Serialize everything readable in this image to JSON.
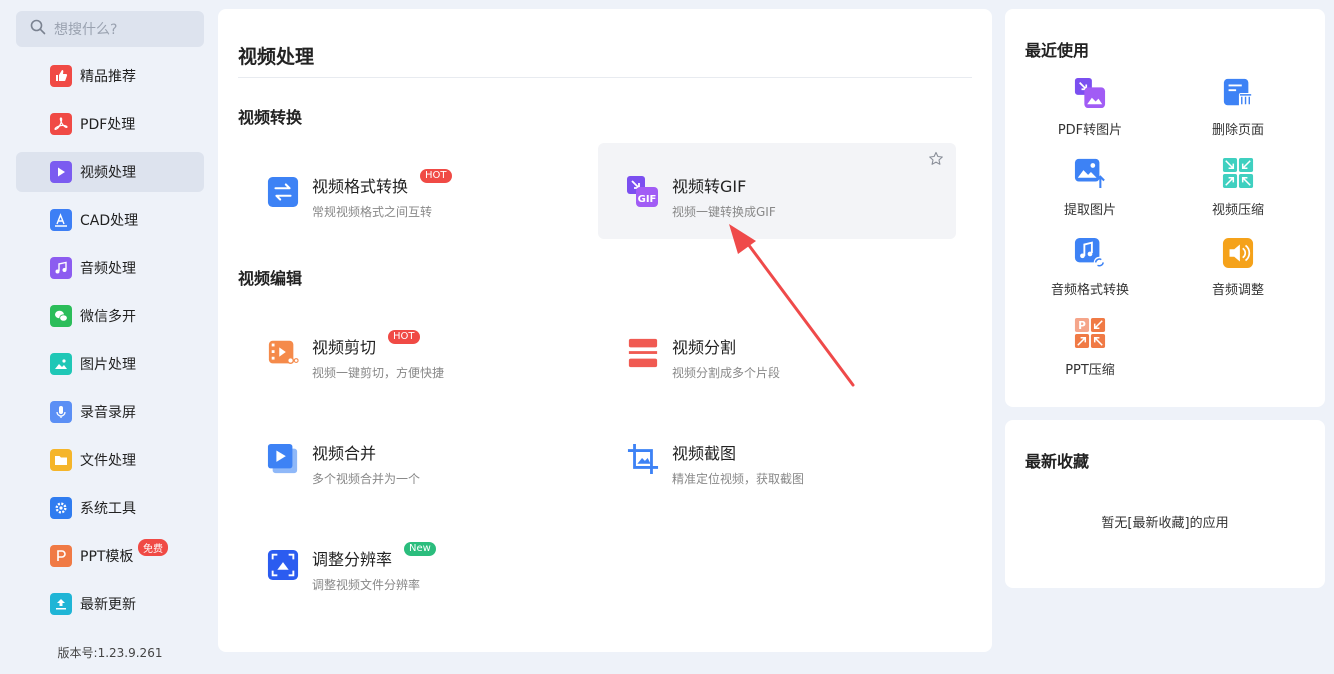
{
  "search": {
    "placeholder": "想搜什么?"
  },
  "sidebar": {
    "items": [
      {
        "label": "精品推荐",
        "icon": "thumbs-up-icon",
        "color": "#f04a45"
      },
      {
        "label": "PDF处理",
        "icon": "pdf-icon",
        "color": "#f04a45"
      },
      {
        "label": "视频处理",
        "icon": "play-icon",
        "color": "#7b5cf0",
        "active": true
      },
      {
        "label": "CAD处理",
        "icon": "cad-icon",
        "color": "#3d7ff5"
      },
      {
        "label": "音频处理",
        "icon": "music-icon",
        "color": "#8c5cf0"
      },
      {
        "label": "微信多开",
        "icon": "wechat-icon",
        "color": "#2bbd5a"
      },
      {
        "label": "图片处理",
        "icon": "image-icon",
        "color": "#1fc7b6"
      },
      {
        "label": "录音录屏",
        "icon": "microphone-icon",
        "color": "#5b8ff5"
      },
      {
        "label": "文件处理",
        "icon": "folder-icon",
        "color": "#f5b52a"
      },
      {
        "label": "系统工具",
        "icon": "gear-icon",
        "color": "#2f7cf0"
      },
      {
        "label": "PPT模板",
        "icon": "ppt-icon",
        "color": "#f07a45",
        "badge": "免费"
      },
      {
        "label": "最新更新",
        "icon": "upload-icon",
        "color": "#1fb5d6"
      }
    ],
    "version": "版本号:1.23.9.261"
  },
  "main": {
    "title": "视频处理",
    "sections": [
      {
        "title": "视频转换"
      },
      {
        "title": "视频编辑"
      }
    ],
    "cards": [
      {
        "title": "视频格式转换",
        "desc": "常规视频格式之间互转",
        "tag": "HOT",
        "icon": "convert-arrows-icon"
      },
      {
        "title": "视频转GIF",
        "desc": "视频一键转换成GIF",
        "icon": "gif-icon"
      },
      {
        "title": "视频剪切",
        "desc": "视频一键剪切，方便快捷",
        "tag": "HOT",
        "icon": "scissors-film-icon"
      },
      {
        "title": "视频分割",
        "desc": "视频分割成多个片段",
        "icon": "split-icon"
      },
      {
        "title": "视频合并",
        "desc": "多个视频合并为一个",
        "icon": "merge-video-icon"
      },
      {
        "title": "视频截图",
        "desc": "精准定位视频，获取截图",
        "icon": "crop-icon"
      },
      {
        "title": "调整分辨率",
        "desc": "调整视频文件分辨率",
        "tag": "New",
        "icon": "resolution-icon"
      }
    ]
  },
  "recent": {
    "title": "最近使用",
    "items": [
      {
        "label": "PDF转图片",
        "icon": "pdf-to-image-icon"
      },
      {
        "label": "删除页面",
        "icon": "delete-page-icon"
      },
      {
        "label": "提取图片",
        "icon": "extract-image-icon"
      },
      {
        "label": "视频压缩",
        "icon": "video-compress-icon"
      },
      {
        "label": "音频格式转换",
        "icon": "audio-convert-icon"
      },
      {
        "label": "音频调整",
        "icon": "audio-adjust-icon"
      },
      {
        "label": "PPT压缩",
        "icon": "ppt-compress-icon"
      }
    ]
  },
  "favorites": {
    "title": "最新收藏",
    "empty_text": "暂无[最新收藏]的应用"
  }
}
